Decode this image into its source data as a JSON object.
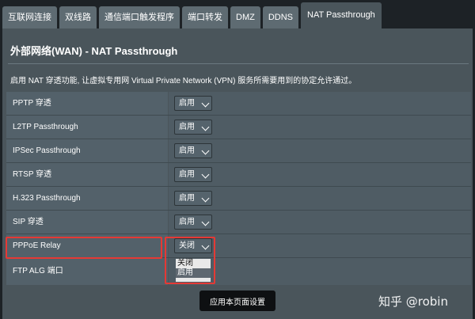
{
  "tabs": [
    {
      "label": "互联网连接",
      "active": false
    },
    {
      "label": "双线路",
      "active": false
    },
    {
      "label": "通信端口触发程序",
      "active": false
    },
    {
      "label": "端口转发",
      "active": false
    },
    {
      "label": "DMZ",
      "active": false
    },
    {
      "label": "DDNS",
      "active": false
    },
    {
      "label": "NAT Passthrough",
      "active": true
    }
  ],
  "page": {
    "title": "外部网络(WAN) - NAT Passthrough",
    "description": "启用 NAT 穿透功能, 让虚拟专用网 Virtual Private Network (VPN) 服务所需要用到的协定允许通过。"
  },
  "settings": [
    {
      "label": "PPTP 穿透",
      "value": "启用"
    },
    {
      "label": "L2TP Passthrough",
      "value": "启用"
    },
    {
      "label": "IPSec Passthrough",
      "value": "启用"
    },
    {
      "label": "RTSP 穿透",
      "value": "启用"
    },
    {
      "label": "H.323 Passthrough",
      "value": "启用"
    },
    {
      "label": "SIP 穿透",
      "value": "启用"
    },
    {
      "label": "PPPoE Relay",
      "value": "关闭"
    },
    {
      "label": "FTP ALG 端口",
      "value": ""
    }
  ],
  "dropdown_options": [
    "关闭",
    "启用"
  ],
  "apply_label": "应用本页面设置",
  "watermark": "知乎 @robin",
  "colors": {
    "highlight": "#e53935",
    "active_tab": "#4a555b",
    "panel": "#4a555b"
  }
}
